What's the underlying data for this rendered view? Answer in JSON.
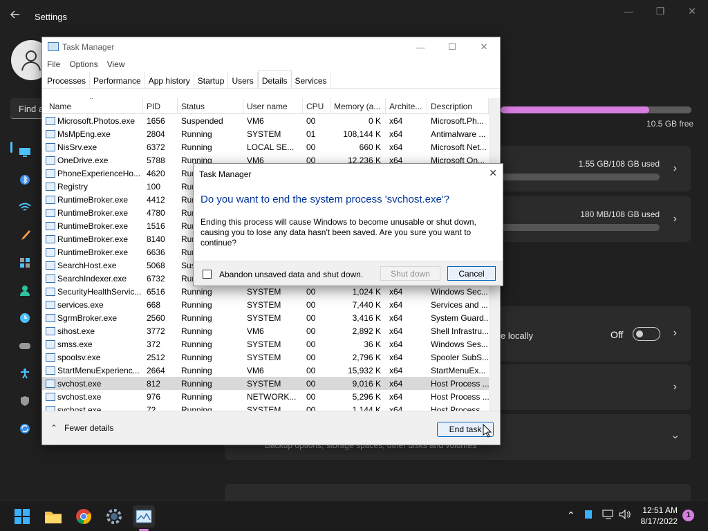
{
  "settings": {
    "title": "Settings",
    "find_placeholder": "Find a",
    "storage_free": "10.5 GB free",
    "storage_used_fraction": 0.78,
    "cards": [
      {
        "used": "1.55 GB/108 GB used"
      },
      {
        "used": "180 MB/108 GB used"
      }
    ],
    "local_text": "e locally",
    "toggle_state": "Off",
    "storage_sub": "Backup options, storage spaces, other disks and volumes"
  },
  "taskmgr": {
    "title": "Task Manager",
    "menu": [
      "File",
      "Options",
      "View"
    ],
    "tabs": [
      "Processes",
      "Performance",
      "App history",
      "Startup",
      "Users",
      "Details",
      "Services"
    ],
    "active_tab": "Details",
    "columns": [
      "Name",
      "PID",
      "Status",
      "User name",
      "CPU",
      "Memory (a...",
      "Archite...",
      "Description"
    ],
    "rows": [
      [
        "Microsoft.Photos.exe",
        "1656",
        "Suspended",
        "VM6",
        "00",
        "0 K",
        "x64",
        "Microsoft.Ph..."
      ],
      [
        "MsMpEng.exe",
        "2804",
        "Running",
        "SYSTEM",
        "01",
        "108,144 K",
        "x64",
        "Antimalware ..."
      ],
      [
        "NisSrv.exe",
        "6372",
        "Running",
        "LOCAL SE...",
        "00",
        "660 K",
        "x64",
        "Microsoft Net..."
      ],
      [
        "OneDrive.exe",
        "5788",
        "Running",
        "VM6",
        "00",
        "12,236 K",
        "x64",
        "Microsoft On..."
      ],
      [
        "PhoneExperienceHo...",
        "4620",
        "Running",
        "",
        "",
        "",
        "",
        ""
      ],
      [
        "Registry",
        "100",
        "Run",
        "",
        "",
        "",
        "",
        ""
      ],
      [
        "RuntimeBroker.exe",
        "4412",
        "Run",
        "",
        "",
        "",
        "",
        ""
      ],
      [
        "RuntimeBroker.exe",
        "4780",
        "Run",
        "",
        "",
        "",
        "",
        ""
      ],
      [
        "RuntimeBroker.exe",
        "1516",
        "Run",
        "",
        "",
        "",
        "",
        ""
      ],
      [
        "RuntimeBroker.exe",
        "8140",
        "Run",
        "",
        "",
        "",
        "",
        ""
      ],
      [
        "RuntimeBroker.exe",
        "6636",
        "Run",
        "",
        "",
        "",
        "",
        ""
      ],
      [
        "SearchHost.exe",
        "5068",
        "Sus",
        "",
        "",
        "",
        "",
        ""
      ],
      [
        "SearchIndexer.exe",
        "6732",
        "Run",
        "",
        "",
        "",
        "",
        ""
      ],
      [
        "SecurityHealthServic...",
        "6516",
        "Running",
        "SYSTEM",
        "00",
        "1,024 K",
        "x64",
        "Windows Sec..."
      ],
      [
        "services.exe",
        "668",
        "Running",
        "SYSTEM",
        "00",
        "7,440 K",
        "x64",
        "Services and ..."
      ],
      [
        "SgrmBroker.exe",
        "2560",
        "Running",
        "SYSTEM",
        "00",
        "3,416 K",
        "x64",
        "System Guard..."
      ],
      [
        "sihost.exe",
        "3772",
        "Running",
        "VM6",
        "00",
        "2,892 K",
        "x64",
        "Shell Infrastru..."
      ],
      [
        "smss.exe",
        "372",
        "Running",
        "SYSTEM",
        "00",
        "36 K",
        "x64",
        "Windows Ses..."
      ],
      [
        "spoolsv.exe",
        "2512",
        "Running",
        "SYSTEM",
        "00",
        "2,796 K",
        "x64",
        "Spooler SubS..."
      ],
      [
        "StartMenuExperienc...",
        "2664",
        "Running",
        "VM6",
        "00",
        "15,932 K",
        "x64",
        "StartMenuEx..."
      ],
      [
        "svchost.exe",
        "812",
        "Running",
        "SYSTEM",
        "00",
        "9,016 K",
        "x64",
        "Host Process ..."
      ],
      [
        "svchost.exe",
        "976",
        "Running",
        "NETWORK...",
        "00",
        "5,296 K",
        "x64",
        "Host Process ..."
      ],
      [
        "svchost.exe",
        "72",
        "Running",
        "SYSTEM",
        "00",
        "1,144 K",
        "x64",
        "Host Process ..."
      ]
    ],
    "selected_row": 20,
    "fewer_details": "Fewer details",
    "end_task": "End task"
  },
  "dialog": {
    "title": "Task Manager",
    "heading": "Do you want to end the system process 'svchost.exe'?",
    "body": "Ending this process will cause Windows to become unusable or shut down, causing you to lose any data hasn't been saved. Are you sure you want to continue?",
    "checkbox_label": "Abandon unsaved data and shut down.",
    "shutdown_label": "Shut down",
    "cancel_label": "Cancel"
  },
  "taskbar": {
    "time": "12:51 AM",
    "date": "8/17/2022",
    "notifications": "1"
  },
  "colors": {
    "accent": "#d67de0",
    "dialog_heading": "#003399",
    "selection": "#d9d9d9"
  }
}
